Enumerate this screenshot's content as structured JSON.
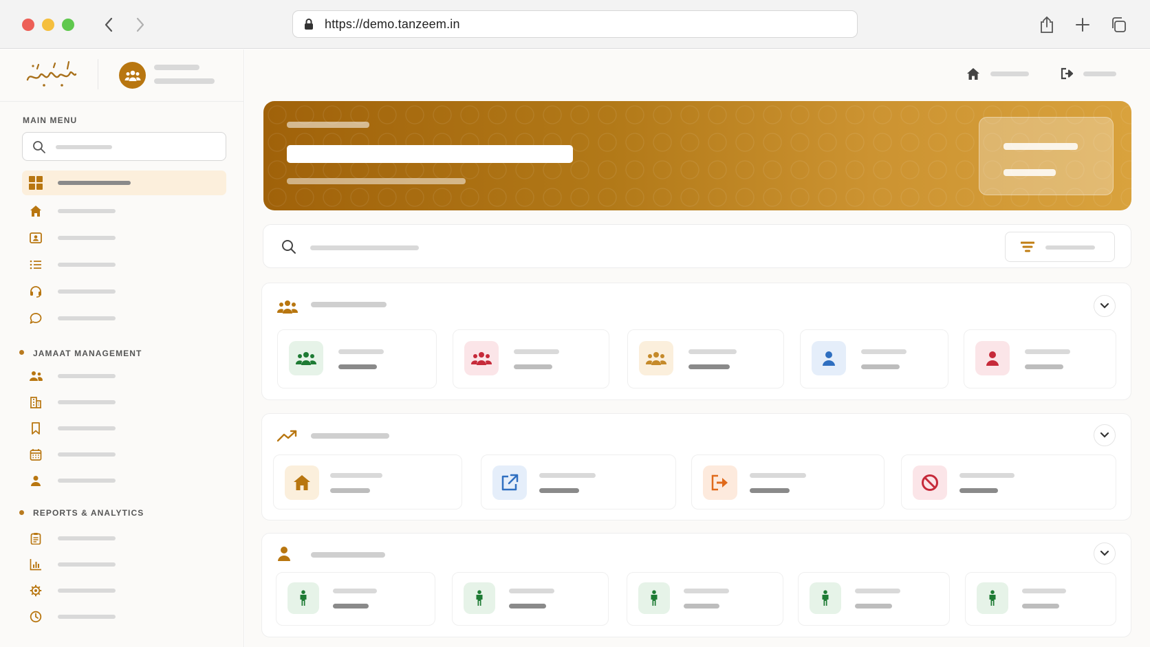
{
  "browser": {
    "url": "https://demo.tanzeem.in"
  },
  "sidebar": {
    "main_menu_label": "MAIN MENU",
    "jamaat_label": "JAMAAT MANAGEMENT",
    "reports_label": "REPORTS & ANALYTICS",
    "main_items": [
      {
        "icon": "dashboard-icon",
        "active": true
      },
      {
        "icon": "home-icon"
      },
      {
        "icon": "id-card-icon"
      },
      {
        "icon": "list-icon"
      },
      {
        "icon": "headset-icon"
      },
      {
        "icon": "chat-icon"
      }
    ],
    "jamaat_items": [
      {
        "icon": "people-icon"
      },
      {
        "icon": "building-icon"
      },
      {
        "icon": "bookmark-icon"
      },
      {
        "icon": "calendar-icon"
      },
      {
        "icon": "user-icon"
      }
    ],
    "report_items": [
      {
        "icon": "clipboard-icon"
      },
      {
        "icon": "bar-chart-icon"
      },
      {
        "icon": "gear-icon"
      },
      {
        "icon": "clock-icon"
      }
    ]
  },
  "colors": {
    "accent": "#b87610",
    "green": "#1e7b34",
    "red": "#c62a3a",
    "blue": "#2f6fc0",
    "orange": "#e06a1b"
  },
  "sections": [
    {
      "icon": "group-icon",
      "cards": [
        "group-green",
        "group-red",
        "group-gold",
        "person-blue",
        "person-red"
      ]
    },
    {
      "icon": "trend-icon",
      "cards": [
        "home-gold",
        "external-link-blue",
        "exit-orange",
        "block-red"
      ]
    },
    {
      "icon": "person-icon",
      "cards": [
        "standing-person-green",
        "standing-person-green",
        "standing-person-green",
        "standing-person-green",
        "standing-person-green"
      ]
    }
  ]
}
